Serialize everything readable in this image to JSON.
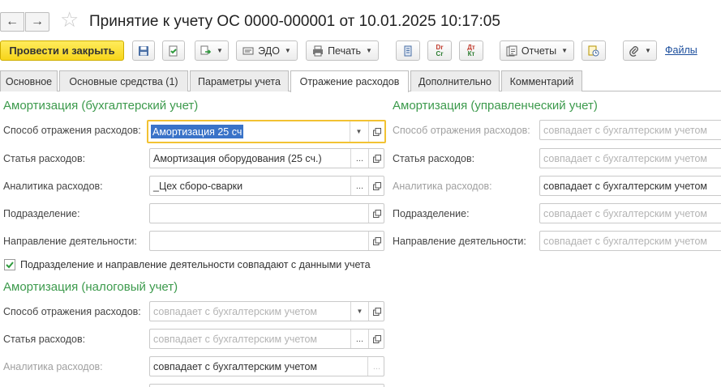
{
  "window": {
    "title": "Принятие к учету ОС 0000-000001 от 10.01.2025 10:17:05",
    "back_glyph": "←",
    "forward_glyph": "→",
    "favorite_glyph": "☆"
  },
  "toolbar": {
    "post_and_close": "Провести и закрыть",
    "edo": "ЭДО",
    "print": "Печать",
    "dt_top": "Dr",
    "dt_bottom": "Cr",
    "dtkt_top": "Дт",
    "dtkt_bottom": "Кт",
    "reports": "Отчеты",
    "files": "Файлы"
  },
  "tabs": [
    {
      "label": "Основное"
    },
    {
      "label": "Основные средства (1)"
    },
    {
      "label": "Параметры учета"
    },
    {
      "label": "Отражение расходов",
      "active": true
    },
    {
      "label": "Дополнительно"
    },
    {
      "label": "Комментарий"
    }
  ],
  "accounting": {
    "title": "Амортизация (бухгалтерский учет)",
    "method_label": "Способ отражения расходов:",
    "method_value": "Амортизация 25 сч",
    "item_label": "Статья расходов:",
    "item_value": "Амортизация оборудования (25 сч.)",
    "analytics_label": "Аналитика расходов:",
    "analytics_value": "_Цех сборо-сварки",
    "division_label": "Подразделение:",
    "division_value": "",
    "activity_label": "Направление деятельности:",
    "activity_value": "",
    "checkbox_label": "Подразделение и направление деятельности совпадают с данными учета",
    "checkbox_checked": true
  },
  "management": {
    "title": "Амортизация (управленческий учет)",
    "method_label": "Способ отражения расходов:",
    "method_placeholder": "совпадает с бухгалтерским учетом",
    "item_label": "Статья расходов:",
    "item_placeholder": "совпадает с бухгалтерским учетом",
    "analytics_label": "Аналитика расходов:",
    "analytics_value": "совпадает с бухгалтерским учетом",
    "division_label": "Подразделение:",
    "division_placeholder": "совпадает с бухгалтерским учетом",
    "activity_label": "Направление деятельности:",
    "activity_placeholder": "совпадает с бухгалтерским учетом"
  },
  "tax": {
    "title": "Амортизация (налоговый учет)",
    "method_label": "Способ отражения расходов:",
    "method_placeholder": "совпадает с бухгалтерским учетом",
    "item_label": "Статья расходов:",
    "item_placeholder": "совпадает с бухгалтерским учетом",
    "analytics_label": "Аналитика расходов:",
    "analytics_value": "совпадает с бухгалтерским учетом"
  },
  "colors": {
    "section_title": "#3c9a4c",
    "primary_button": "#f7d51a",
    "focus_border": "#f2c233",
    "selection": "#3a73c8",
    "link": "#1a4d9c"
  }
}
